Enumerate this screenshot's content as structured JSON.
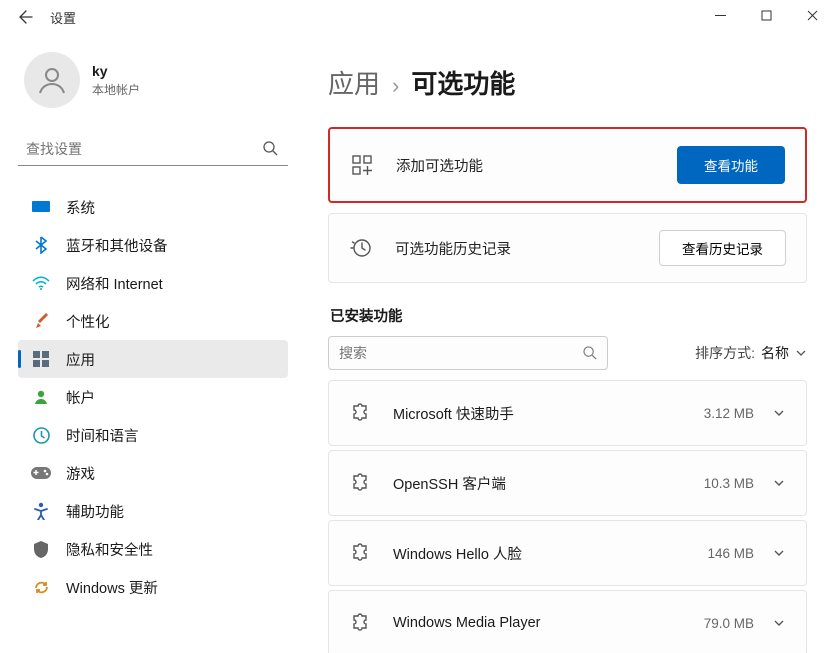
{
  "window": {
    "title": "设置"
  },
  "user": {
    "name": "ky",
    "subtitle": "本地帐户"
  },
  "search": {
    "placeholder": "查找设置"
  },
  "nav": {
    "items": [
      {
        "label": "系统",
        "icon": "monitor",
        "color": "#0078d4"
      },
      {
        "label": "蓝牙和其他设备",
        "icon": "bluetooth",
        "color": "#0078d4"
      },
      {
        "label": "网络和 Internet",
        "icon": "wifi",
        "color": "#00afd4"
      },
      {
        "label": "个性化",
        "icon": "brush",
        "color": "#c95f2d"
      },
      {
        "label": "应用",
        "icon": "apps",
        "color": "#5a6b7b",
        "active": true
      },
      {
        "label": "帐户",
        "icon": "account",
        "color": "#3ba53b"
      },
      {
        "label": "时间和语言",
        "icon": "time",
        "color": "#1c98a9"
      },
      {
        "label": "游戏",
        "icon": "game",
        "color": "#777"
      },
      {
        "label": "辅助功能",
        "icon": "access",
        "color": "#2a5fb0"
      },
      {
        "label": "隐私和安全性",
        "icon": "privacy",
        "color": "#666"
      },
      {
        "label": "Windows 更新",
        "icon": "update",
        "color": "#d88a1a"
      }
    ]
  },
  "breadcrumb": {
    "parent": "应用",
    "current": "可选功能"
  },
  "panels": {
    "add": {
      "label": "添加可选功能",
      "button": "查看功能"
    },
    "history": {
      "label": "可选功能历史记录",
      "button": "查看历史记录"
    }
  },
  "installed": {
    "title": "已安装功能",
    "search_placeholder": "搜索",
    "sort_prefix": "排序方式:",
    "sort_value": "名称",
    "items": [
      {
        "name": "Microsoft 快速助手",
        "size": "3.12 MB"
      },
      {
        "name": "OpenSSH 客户端",
        "size": "10.3 MB"
      },
      {
        "name": "Windows Hello 人脸",
        "size": "146 MB"
      },
      {
        "name": "Windows Media Player",
        "size": "79.0 MB"
      }
    ]
  }
}
